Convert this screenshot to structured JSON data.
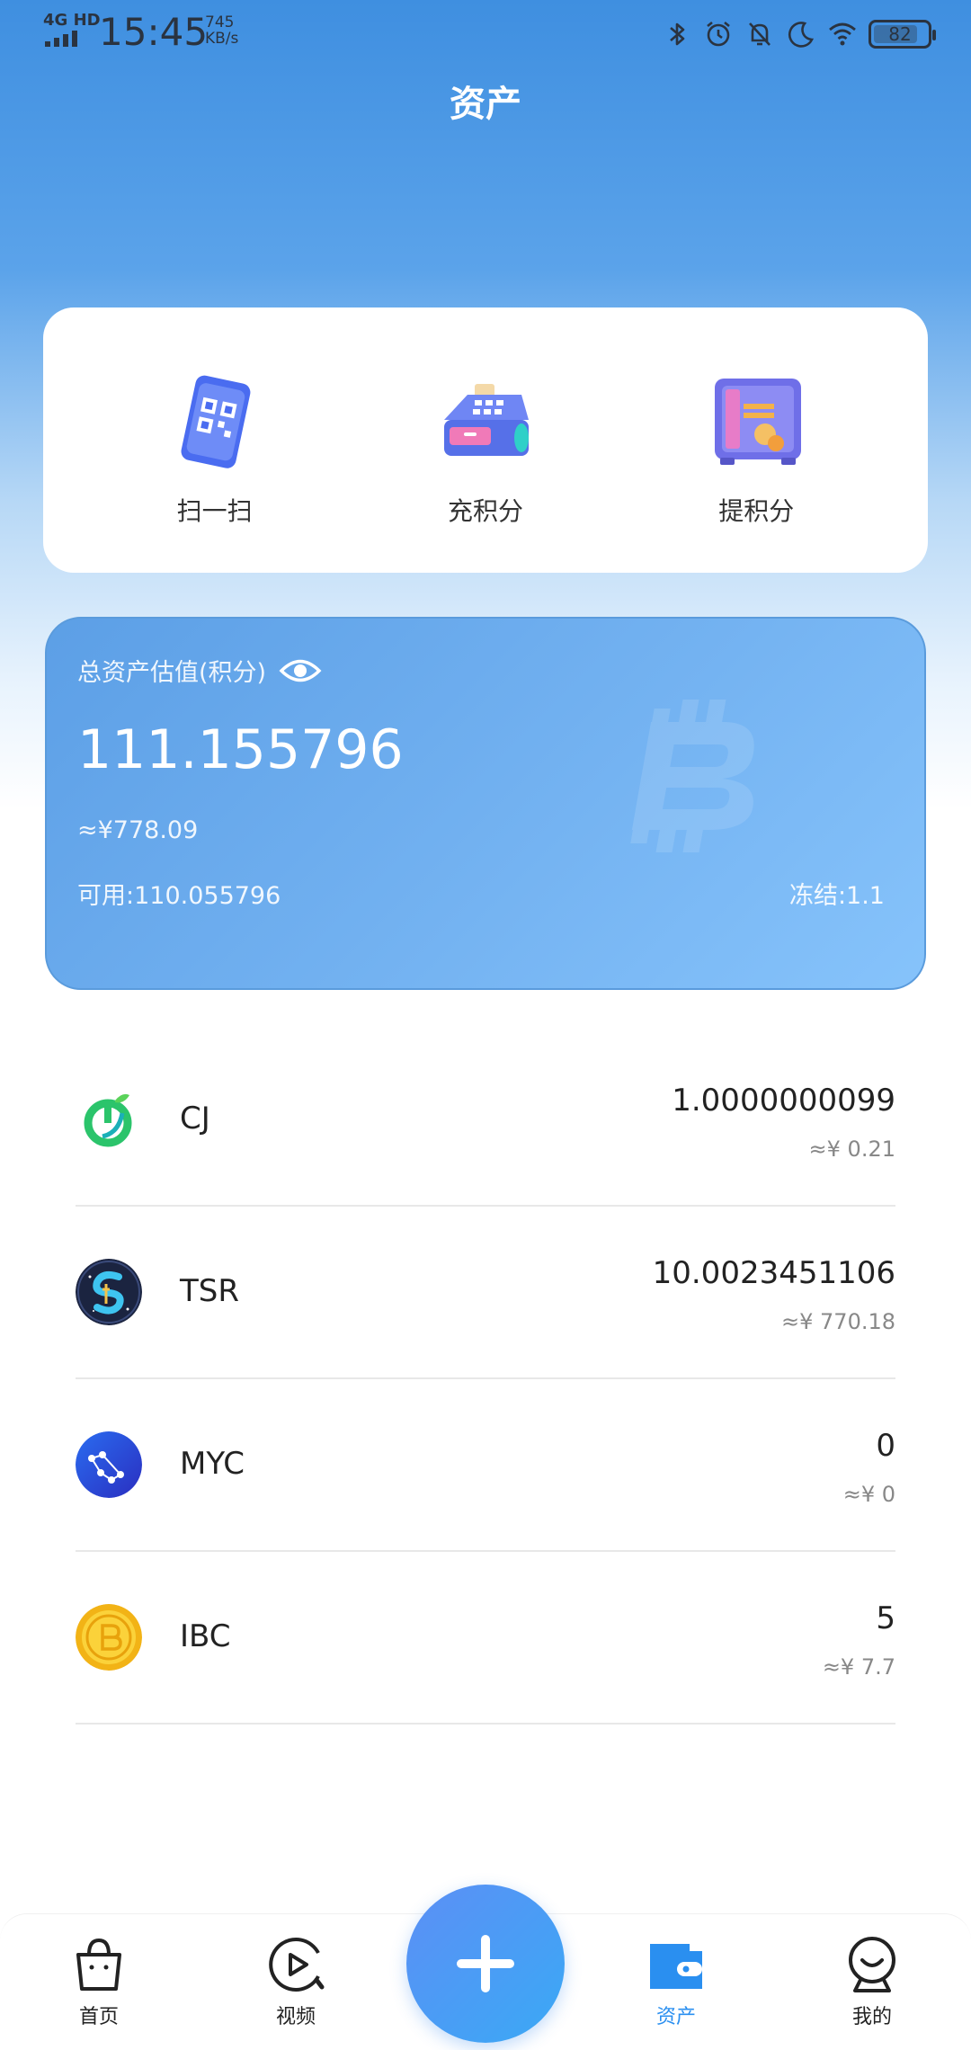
{
  "status_bar": {
    "network": "4G HD",
    "time": "15:45",
    "speed_value": "745",
    "speed_unit": "KB/s",
    "battery": "82",
    "battery_level": 0.82,
    "icons": [
      "bluetooth-icon",
      "alarm-icon",
      "mute-icon",
      "moon-icon",
      "wifi-icon",
      "battery-icon"
    ]
  },
  "header": {
    "title": "资产"
  },
  "actions": [
    {
      "label": "扫一扫",
      "icon": "qr-phone-icon"
    },
    {
      "label": "充积分",
      "icon": "cash-register-icon"
    },
    {
      "label": "提积分",
      "icon": "safe-icon"
    }
  ],
  "balance": {
    "label": "总资产估值(积分)",
    "amount": "111.155796",
    "cny": "≈¥778.09",
    "available": "可用:110.055796",
    "frozen": "冻结:1.1"
  },
  "assets": [
    {
      "symbol": "CJ",
      "amount": "1.0000000099",
      "cny": "≈¥ 0.21",
      "icon": "cj-coin-icon"
    },
    {
      "symbol": "TSR",
      "amount": "10.0023451106",
      "cny": "≈¥ 770.18",
      "icon": "tsr-coin-icon"
    },
    {
      "symbol": "MYC",
      "amount": "0",
      "cny": "≈¥ 0",
      "icon": "myc-coin-icon"
    },
    {
      "symbol": "IBC",
      "amount": "5",
      "cny": "≈¥ 7.7",
      "icon": "ibc-coin-icon"
    }
  ],
  "nav": {
    "items": [
      {
        "label": "首页",
        "icon": "shopping-bag-icon"
      },
      {
        "label": "视频",
        "icon": "play-icon"
      },
      {
        "label": "资产",
        "icon": "wallet-icon",
        "active": true
      },
      {
        "label": "我的",
        "icon": "profile-icon"
      }
    ],
    "fab_icon": "plus-icon"
  },
  "colors": {
    "accent": "#2a8ff0",
    "header_blue": "#3f8fe0",
    "card_blue": "#73b2f1"
  }
}
